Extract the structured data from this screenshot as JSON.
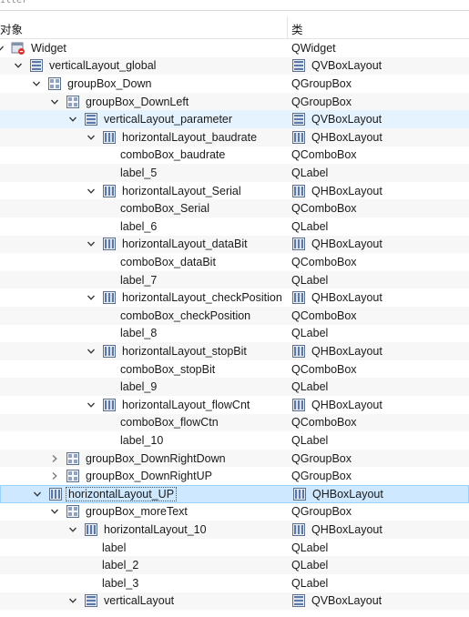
{
  "filter_label": "ilter",
  "header": {
    "object_col": "对象",
    "class_col": "类"
  },
  "rows": [
    {
      "depth": 0,
      "arrow": "down",
      "icon": "widget",
      "name": "Widget",
      "cls": "QWidget",
      "cls_icon": ""
    },
    {
      "depth": 1,
      "arrow": "down",
      "icon": "vbox",
      "name": "verticalLayout_global",
      "cls": "QVBoxLayout",
      "cls_icon": "vbox"
    },
    {
      "depth": 2,
      "arrow": "down",
      "icon": "groupbox",
      "name": "groupBox_Down",
      "cls": "QGroupBox",
      "cls_icon": ""
    },
    {
      "depth": 3,
      "arrow": "down",
      "icon": "groupbox",
      "name": "groupBox_DownLeft",
      "cls": "QGroupBox",
      "cls_icon": ""
    },
    {
      "depth": 4,
      "arrow": "down",
      "icon": "vbox",
      "name": "verticalLayout_parameter",
      "cls": "QVBoxLayout",
      "cls_icon": "vbox",
      "state": "hl"
    },
    {
      "depth": 5,
      "arrow": "down",
      "icon": "hbox",
      "name": "horizontalLayout_baudrate",
      "cls": "QHBoxLayout",
      "cls_icon": "hbox"
    },
    {
      "depth": 6,
      "arrow": "",
      "icon": "",
      "name": "comboBox_baudrate",
      "cls": "QComboBox",
      "cls_icon": ""
    },
    {
      "depth": 6,
      "arrow": "",
      "icon": "",
      "name": "label_5",
      "cls": "QLabel",
      "cls_icon": ""
    },
    {
      "depth": 5,
      "arrow": "down",
      "icon": "hbox",
      "name": "horizontalLayout_Serial",
      "cls": "QHBoxLayout",
      "cls_icon": "hbox"
    },
    {
      "depth": 6,
      "arrow": "",
      "icon": "",
      "name": "comboBox_Serial",
      "cls": "QComboBox",
      "cls_icon": ""
    },
    {
      "depth": 6,
      "arrow": "",
      "icon": "",
      "name": "label_6",
      "cls": "QLabel",
      "cls_icon": ""
    },
    {
      "depth": 5,
      "arrow": "down",
      "icon": "hbox",
      "name": "horizontalLayout_dataBit",
      "cls": "QHBoxLayout",
      "cls_icon": "hbox"
    },
    {
      "depth": 6,
      "arrow": "",
      "icon": "",
      "name": "comboBox_dataBit",
      "cls": "QComboBox",
      "cls_icon": ""
    },
    {
      "depth": 6,
      "arrow": "",
      "icon": "",
      "name": "label_7",
      "cls": "QLabel",
      "cls_icon": ""
    },
    {
      "depth": 5,
      "arrow": "down",
      "icon": "hbox",
      "name": "horizontalLayout_checkPosition",
      "cls": "QHBoxLayout",
      "cls_icon": "hbox"
    },
    {
      "depth": 6,
      "arrow": "",
      "icon": "",
      "name": "comboBox_checkPosition",
      "cls": "QComboBox",
      "cls_icon": ""
    },
    {
      "depth": 6,
      "arrow": "",
      "icon": "",
      "name": "label_8",
      "cls": "QLabel",
      "cls_icon": ""
    },
    {
      "depth": 5,
      "arrow": "down",
      "icon": "hbox",
      "name": "horizontalLayout_stopBit",
      "cls": "QHBoxLayout",
      "cls_icon": "hbox"
    },
    {
      "depth": 6,
      "arrow": "",
      "icon": "",
      "name": "comboBox_stopBit",
      "cls": "QComboBox",
      "cls_icon": ""
    },
    {
      "depth": 6,
      "arrow": "",
      "icon": "",
      "name": "label_9",
      "cls": "QLabel",
      "cls_icon": ""
    },
    {
      "depth": 5,
      "arrow": "down",
      "icon": "hbox",
      "name": "horizontalLayout_flowCnt",
      "cls": "QHBoxLayout",
      "cls_icon": "hbox"
    },
    {
      "depth": 6,
      "arrow": "",
      "icon": "",
      "name": "comboBox_flowCtn",
      "cls": "QComboBox",
      "cls_icon": ""
    },
    {
      "depth": 6,
      "arrow": "",
      "icon": "",
      "name": "label_10",
      "cls": "QLabel",
      "cls_icon": ""
    },
    {
      "depth": 3,
      "arrow": "right",
      "icon": "groupbox",
      "name": "groupBox_DownRightDown",
      "cls": "QGroupBox",
      "cls_icon": ""
    },
    {
      "depth": 3,
      "arrow": "right",
      "icon": "groupbox",
      "name": "groupBox_DownRightUP",
      "cls": "QGroupBox",
      "cls_icon": ""
    },
    {
      "depth": 2,
      "arrow": "down",
      "icon": "hbox",
      "name": "horizontalLayout_UP",
      "cls": "QHBoxLayout",
      "cls_icon": "hbox",
      "state": "sel"
    },
    {
      "depth": 3,
      "arrow": "down",
      "icon": "groupbox",
      "name": "groupBox_moreText",
      "cls": "QGroupBox",
      "cls_icon": ""
    },
    {
      "depth": 4,
      "arrow": "down",
      "icon": "hbox",
      "name": "horizontalLayout_10",
      "cls": "QHBoxLayout",
      "cls_icon": "hbox"
    },
    {
      "depth": 5,
      "arrow": "",
      "icon": "",
      "name": "label",
      "cls": "QLabel",
      "cls_icon": ""
    },
    {
      "depth": 5,
      "arrow": "",
      "icon": "",
      "name": "label_2",
      "cls": "QLabel",
      "cls_icon": ""
    },
    {
      "depth": 5,
      "arrow": "",
      "icon": "",
      "name": "label_3",
      "cls": "QLabel",
      "cls_icon": ""
    },
    {
      "depth": 4,
      "arrow": "down",
      "icon": "vbox",
      "name": "verticalLayout",
      "cls": "QVBoxLayout",
      "cls_icon": "vbox"
    }
  ]
}
